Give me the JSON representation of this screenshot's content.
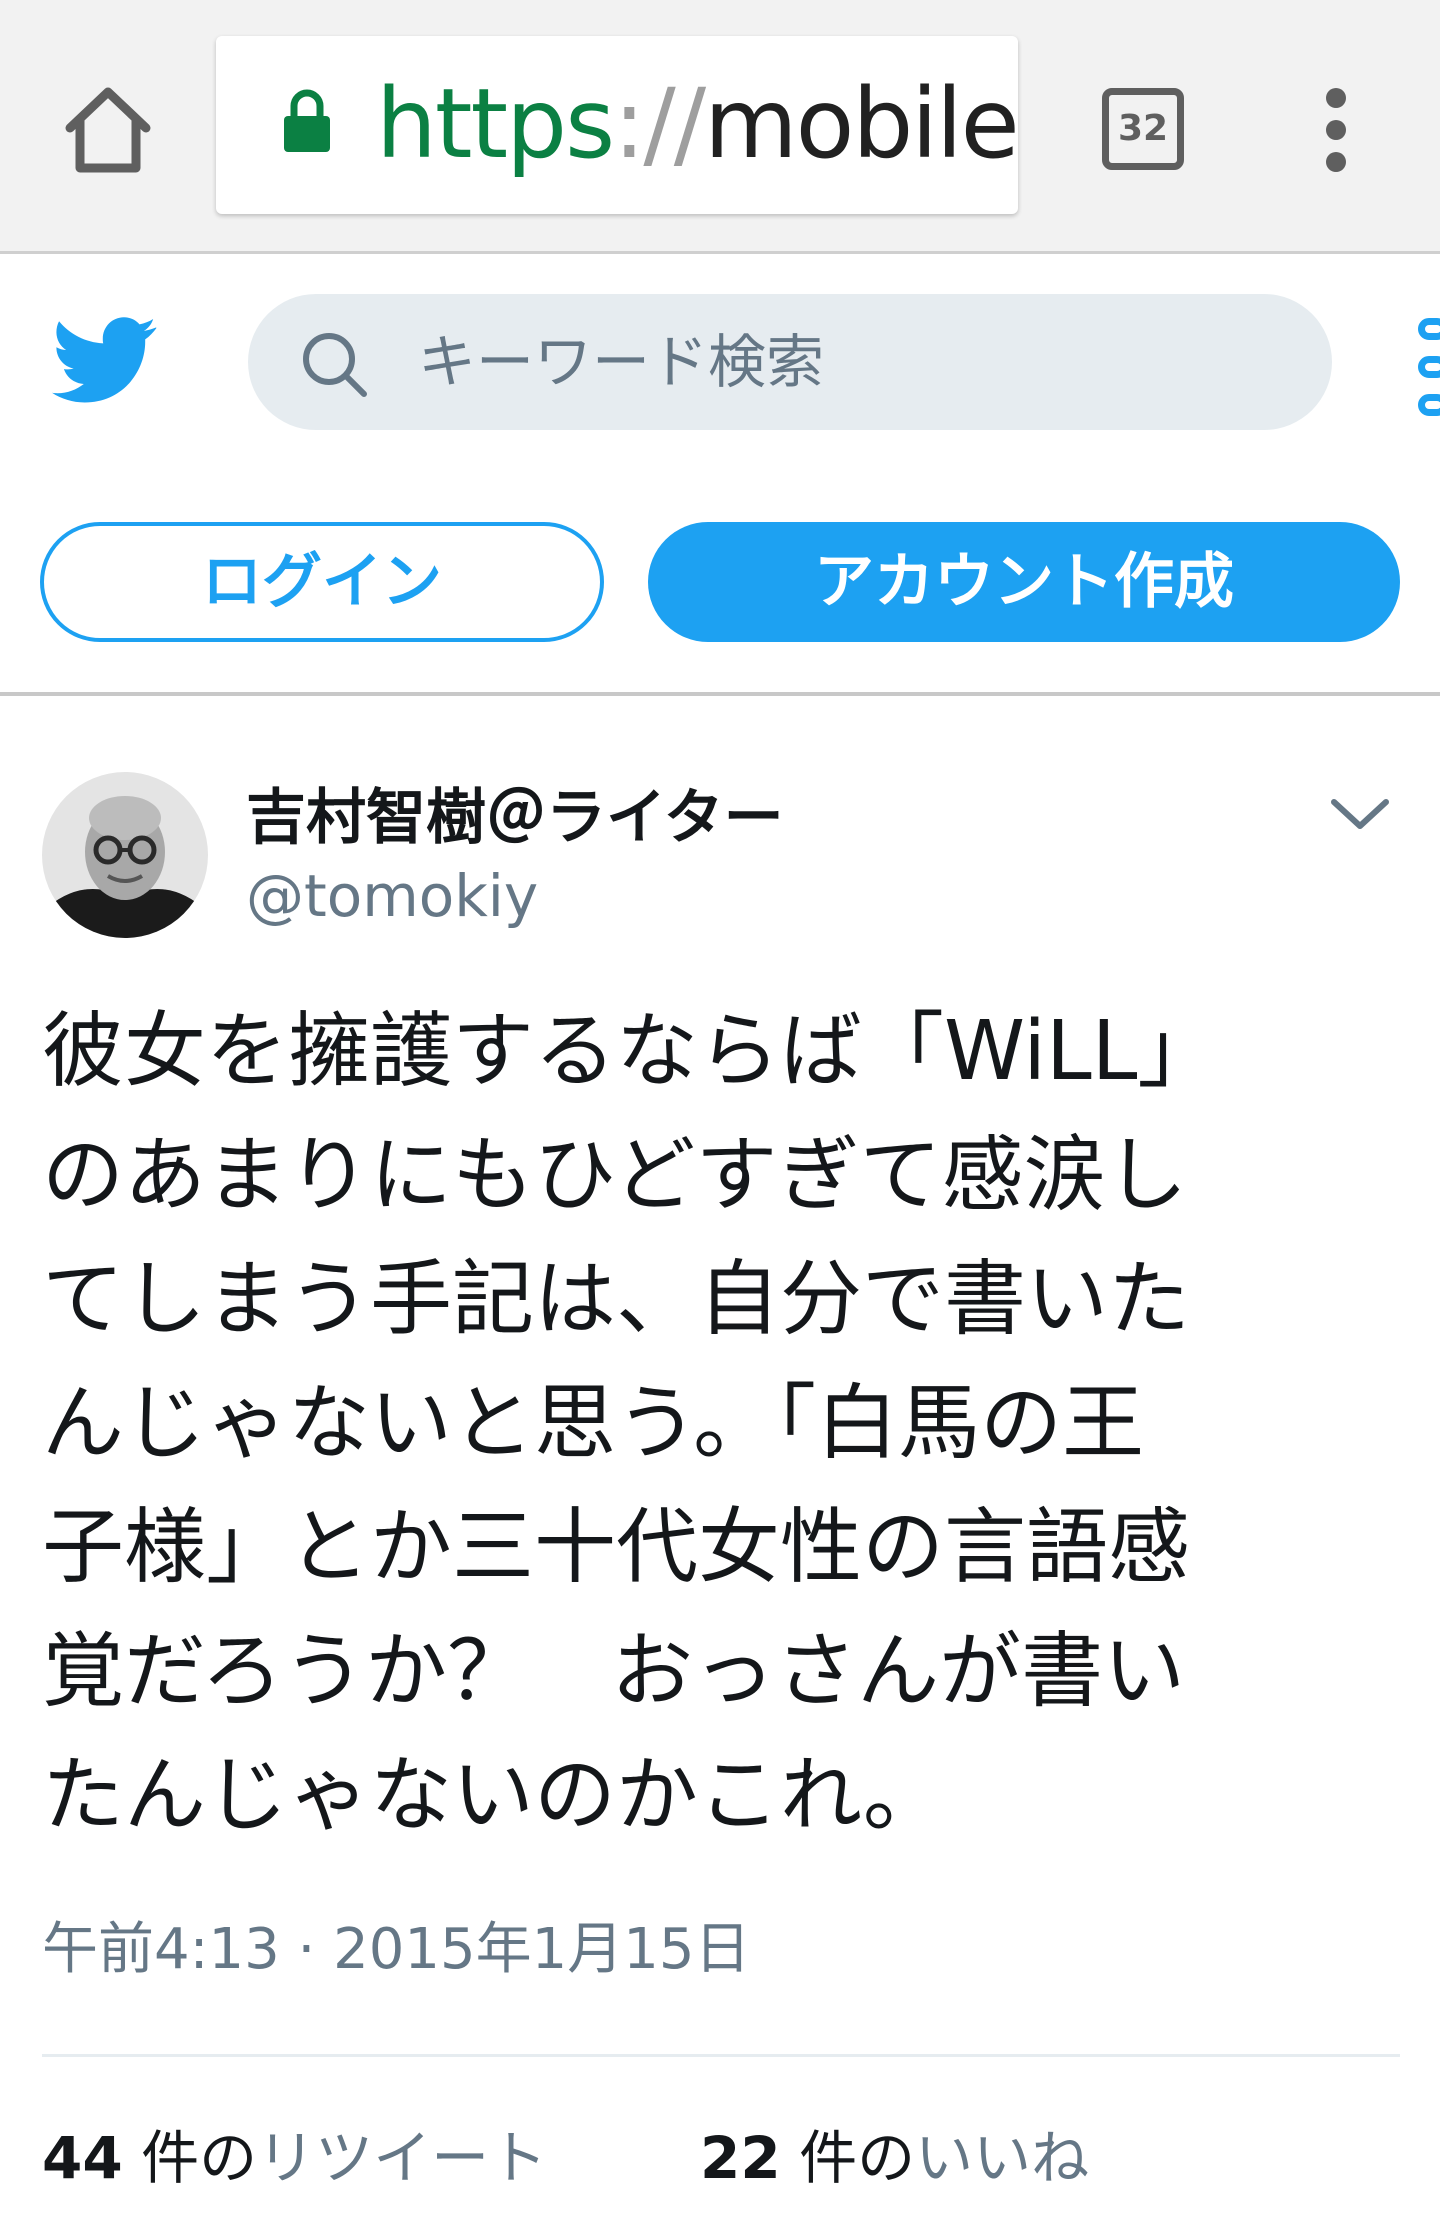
{
  "browser": {
    "url_scheme": "https",
    "url_separator": "://",
    "url_host": "mobile.",
    "tab_count": "32",
    "colors": {
      "secure": "#0b8043",
      "chrome_bg": "#f2f2f2",
      "icon": "#5f5f5f"
    },
    "icons": [
      "home-icon",
      "lock-icon",
      "tabs-icon",
      "overflow-menu-icon"
    ]
  },
  "header": {
    "search_placeholder": "キーワード検索",
    "login_label": "ログイン",
    "signup_label": "アカウント作成",
    "brand_color": "#1da1f2",
    "icons": [
      "twitter-bird-icon",
      "search-icon",
      "menu-icon"
    ]
  },
  "tweet": {
    "author_name": "吉村智樹＠ライター",
    "author_handle": "@tomokiy",
    "lines": [
      "彼女を擁護するならば「WiLL」",
      "のあまりにもひどすぎて感涙し",
      "てしまう手記は、自分で書いた",
      "んじゃないと思う。「白馬の王",
      "子様」とか三十代女性の言語感",
      "覚だろうか？　おっさんが書い",
      "たんじゃないのかこれ。"
    ],
    "timestamp": "午前4:13 · 2015年1月15日",
    "retweets": {
      "count": "44",
      "unit": " 件の",
      "label": "リツイート"
    },
    "likes": {
      "count": "22",
      "unit": " 件の",
      "label": "いいね"
    }
  }
}
